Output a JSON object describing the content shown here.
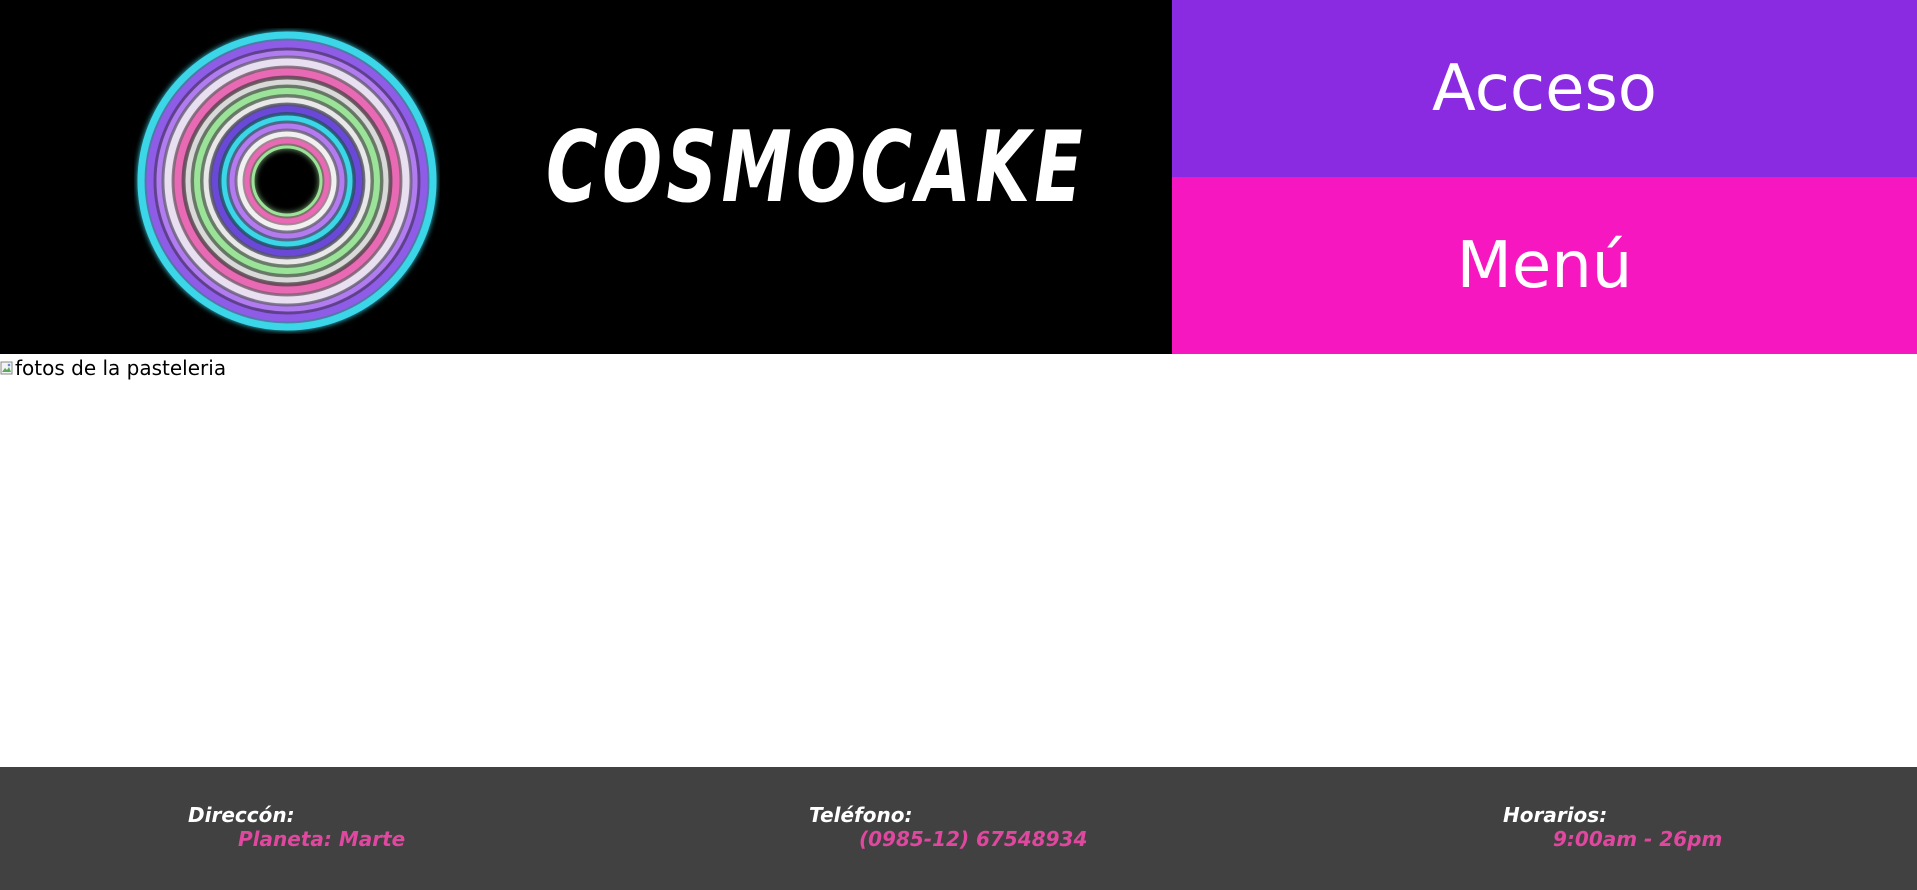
{
  "header": {
    "brand_name": "COSMOCAKE",
    "logo_icon": "neon-rings-logo"
  },
  "nav": {
    "access_label": "Acceso",
    "menu_label": "Menú"
  },
  "hero": {
    "image_alt": "fotos de la pasteleria"
  },
  "footer": {
    "address_label": "Direccón:",
    "address_value": "Planeta: Marte",
    "phone_label": "Teléfono:",
    "phone_value": "(0985-12) 67548934",
    "hours_label": "Horarios:",
    "hours_value": "9:00am - 26pm"
  },
  "colors": {
    "header_bg": "#000000",
    "access_bg": "#8a2be2",
    "menu_bg": "#f617c1",
    "footer_bg": "#414141",
    "accent_text": "#e0479e"
  }
}
